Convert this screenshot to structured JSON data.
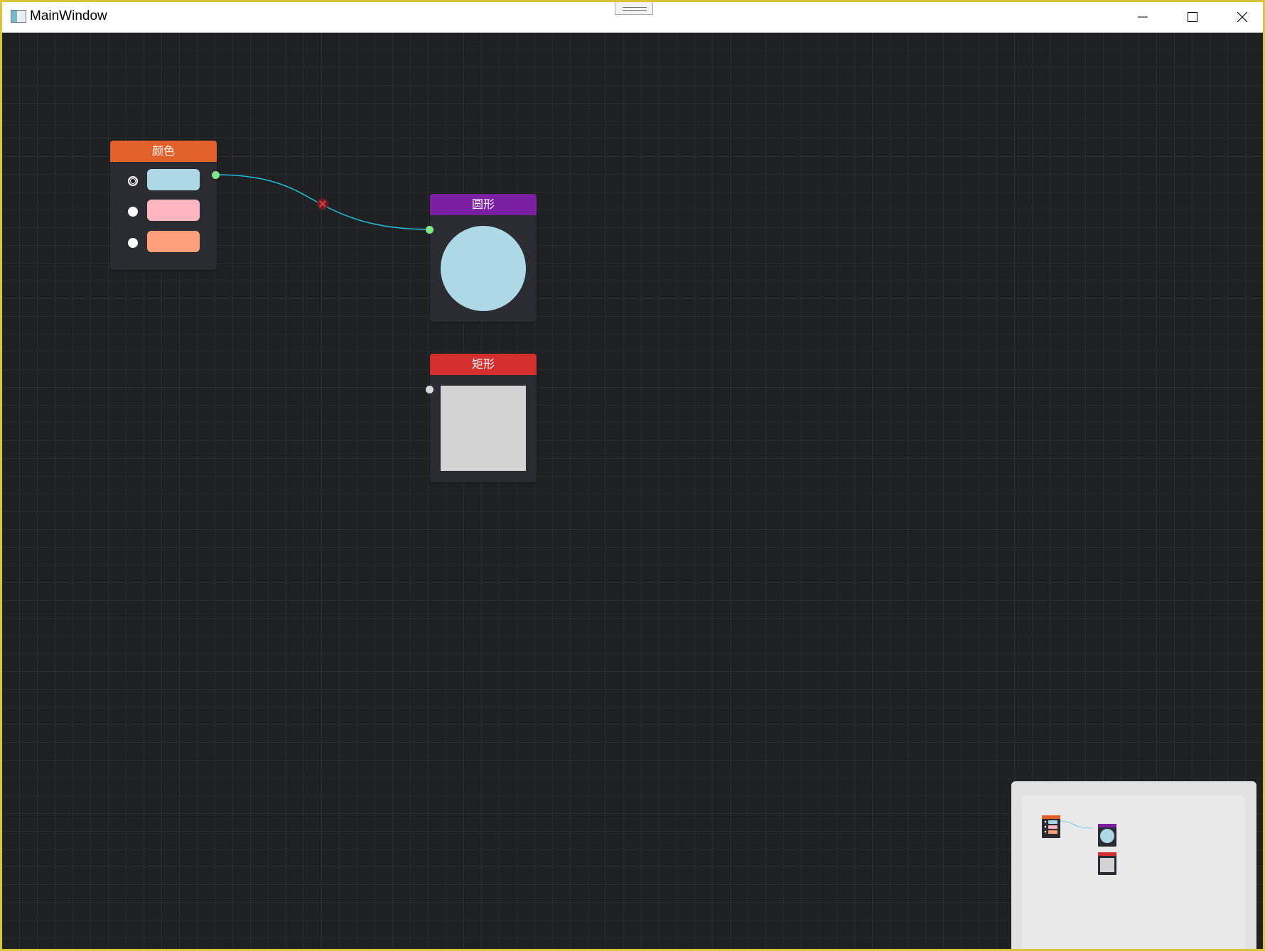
{
  "window": {
    "title": "MainWindow",
    "controls": [
      "minimize-icon",
      "maximize-icon",
      "close-icon"
    ]
  },
  "nodes": {
    "color": {
      "title": "颜色",
      "header_color": "#e2602a",
      "options": [
        {
          "color": "#add8e6",
          "selected": true
        },
        {
          "color": "#ffb6c1",
          "selected": false
        },
        {
          "color": "#ffa07a",
          "selected": false
        }
      ]
    },
    "circle": {
      "title": "圆形",
      "header_color": "#7b1fa2",
      "fill": "#add8e6"
    },
    "rect": {
      "title": "矩形",
      "header_color": "#d32f2f",
      "fill": "#d3d3d3"
    }
  },
  "connection": {
    "color": "#1ebedc",
    "from": "color.output",
    "to": "circle.input",
    "delete_icon": "close-icon"
  },
  "colors": {
    "canvas_bg": "#1f2022",
    "grid": "#2b2c2f",
    "port_connected": "#7ee787",
    "port_unconnected": "#d9d9d9",
    "window_border": "#d8c53a",
    "minimap_bg": "#e1e1e1"
  }
}
